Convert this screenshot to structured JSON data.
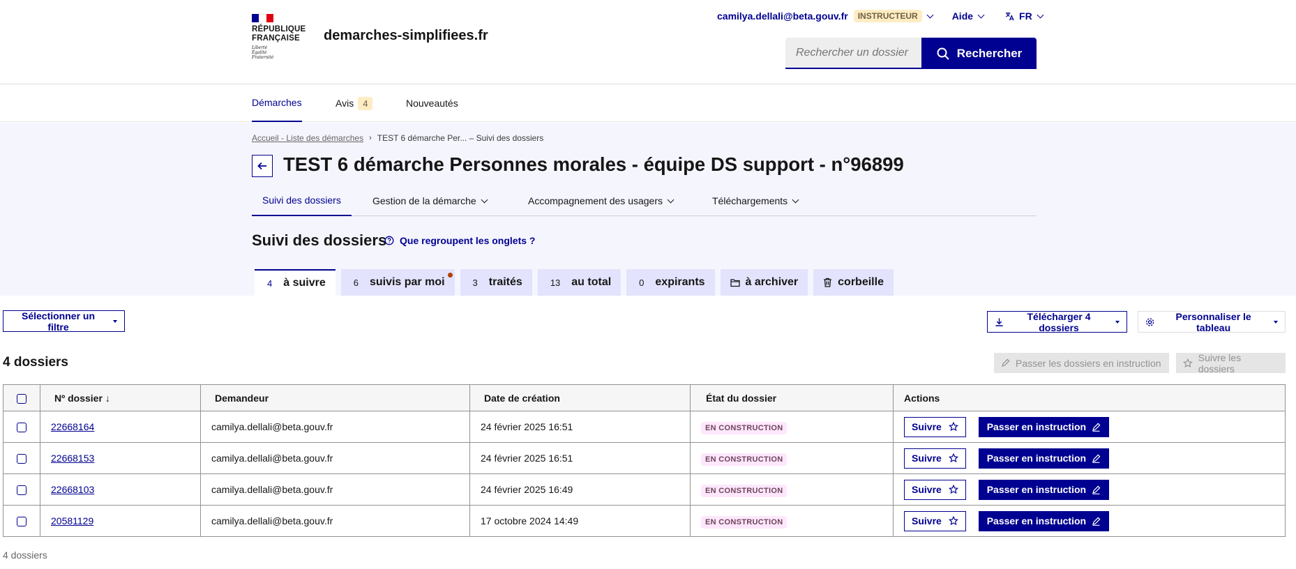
{
  "header": {
    "logo_lines": [
      "RÉPUBLIQUE",
      "FRANÇAISE"
    ],
    "devise": [
      "Liberté",
      "Égalité",
      "Fraternité"
    ],
    "site_name": "demarches-simplifiees.fr",
    "user_email": "camilya.dellali@beta.gouv.fr",
    "role_badge": "INSTRUCTEUR",
    "help_label": "Aide",
    "lang_label": "FR",
    "search_placeholder": "Rechercher un dossier (",
    "search_button": "Rechercher",
    "flag_colors": [
      "#000091",
      "#ffffff",
      "#e1000f"
    ]
  },
  "main_nav": {
    "items": [
      {
        "label": "Démarches"
      },
      {
        "label": "Avis",
        "count": "4"
      },
      {
        "label": "Nouveautés"
      }
    ]
  },
  "breadcrumb": {
    "home": "Accueil - Liste des démarches",
    "current": "TEST 6 démarche Per... – Suivi des dossiers"
  },
  "page_title": "TEST 6 démarche Personnes morales - équipe DS support - n°96899",
  "sub_tabs": [
    {
      "label": "Suivi des dossiers"
    },
    {
      "label": "Gestion de la démarche"
    },
    {
      "label": "Accompagnement des usagers"
    },
    {
      "label": "Téléchargements"
    }
  ],
  "section": {
    "title": "Suivi des dossiers",
    "help_link": "Que regroupent les onglets ?"
  },
  "tabs": [
    {
      "count": "4",
      "label": "à suivre"
    },
    {
      "count": "6",
      "label": "suivis par moi"
    },
    {
      "count": "3",
      "label": "traités"
    },
    {
      "count": "13",
      "label": "au total"
    },
    {
      "count": "0",
      "label": "expirants"
    },
    {
      "label": "à archiver"
    },
    {
      "label": "corbeille"
    }
  ],
  "toolbar": {
    "filter_button": "Sélectionner un filtre",
    "download_button": "Télécharger 4 dossiers",
    "customize_button": "Personnaliser le tableau",
    "count_title": "4 dossiers",
    "bulk_instruction": "Passer les dossiers en instruction",
    "bulk_follow": "Suivre les dossiers"
  },
  "table": {
    "headers": [
      "Nº dossier",
      "Demandeur",
      "Date de création",
      "État du dossier",
      "Actions"
    ],
    "rows": [
      {
        "num": "22668164",
        "demandeur": "camilya.dellali@beta.gouv.fr",
        "date": "24 février 2025 16:51",
        "etat": "EN CONSTRUCTION"
      },
      {
        "num": "22668153",
        "demandeur": "camilya.dellali@beta.gouv.fr",
        "date": "24 février 2025 16:51",
        "etat": "EN CONSTRUCTION"
      },
      {
        "num": "22668103",
        "demandeur": "camilya.dellali@beta.gouv.fr",
        "date": "24 février 2025 16:49",
        "etat": "EN CONSTRUCTION"
      },
      {
        "num": "20581129",
        "demandeur": "camilya.dellali@beta.gouv.fr",
        "date": "17 octobre 2024 14:49",
        "etat": "EN CONSTRUCTION"
      }
    ],
    "action_follow": "Suivre",
    "action_instruct": "Passer en instruction"
  },
  "footer_count": "4 dossiers"
}
